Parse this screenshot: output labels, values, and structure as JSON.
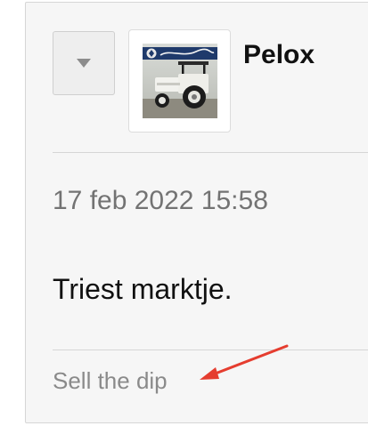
{
  "post": {
    "username": "Pelox",
    "timestamp": "17 feb 2022 15:58",
    "message": "Triest marktje.",
    "signature": "Sell the dip"
  },
  "icons": {
    "vote": "triangle-down-icon",
    "avatar": "lamborghini-tractor-avatar",
    "annotation": "red-arrow-icon"
  },
  "colors": {
    "arrow": "#e53d2f",
    "card_background": "#f6f6f6"
  }
}
